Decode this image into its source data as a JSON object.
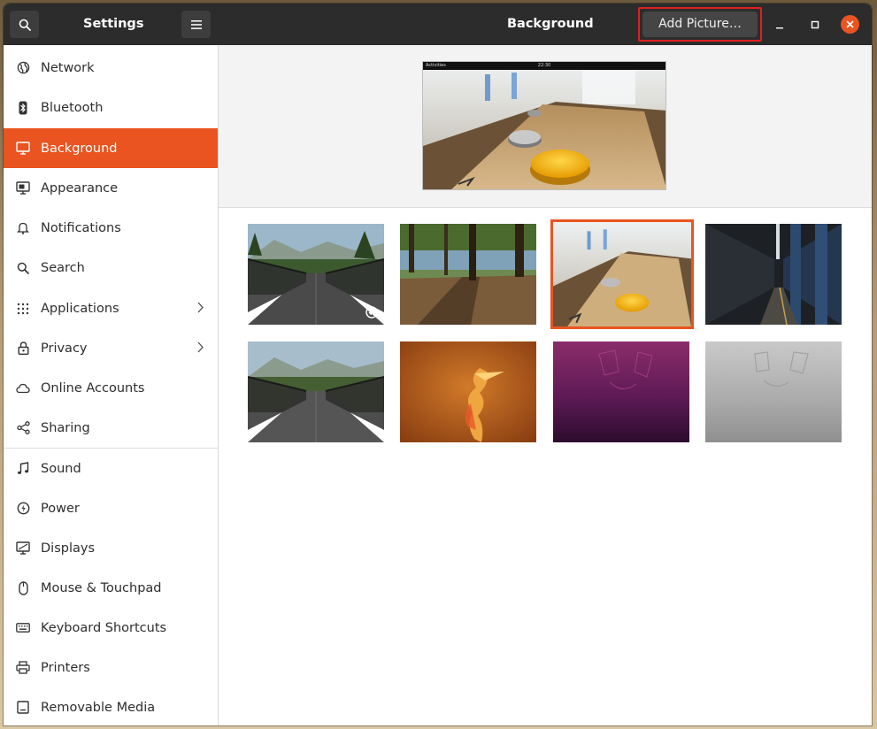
{
  "headerbar": {
    "left_title": "Settings",
    "panel_title": "Background",
    "add_picture_label": "Add Picture…"
  },
  "sidebar": {
    "items": [
      {
        "label": "Network",
        "icon": "network-icon"
      },
      {
        "label": "Bluetooth",
        "icon": "bluetooth-icon"
      },
      {
        "label": "Background",
        "icon": "background-icon",
        "active": true
      },
      {
        "label": "Appearance",
        "icon": "appearance-icon"
      },
      {
        "label": "Notifications",
        "icon": "bell-icon"
      },
      {
        "label": "Search",
        "icon": "search-icon"
      },
      {
        "label": "Applications",
        "icon": "applications-grid-icon",
        "has_submenu": true
      },
      {
        "label": "Privacy",
        "icon": "lock-icon",
        "has_submenu": true
      },
      {
        "label": "Online Accounts",
        "icon": "cloud-icon"
      },
      {
        "label": "Sharing",
        "icon": "share-icon"
      },
      {
        "label": "Sound",
        "icon": "music-note-icon"
      },
      {
        "label": "Power",
        "icon": "power-icon"
      },
      {
        "label": "Displays",
        "icon": "display-icon"
      },
      {
        "label": "Mouse & Touchpad",
        "icon": "mouse-icon"
      },
      {
        "label": "Keyboard Shortcuts",
        "icon": "keyboard-icon"
      },
      {
        "label": "Printers",
        "icon": "printer-icon"
      },
      {
        "label": "Removable Media",
        "icon": "removable-media-icon"
      }
    ]
  },
  "preview": {
    "topbar_activities": "Activities",
    "topbar_clock": "22:30"
  },
  "wallpapers": [
    {
      "name": "bridge-forest",
      "current": true
    },
    {
      "name": "forest-lake"
    },
    {
      "name": "shuffleboard",
      "selected": true
    },
    {
      "name": "subway-corridor"
    },
    {
      "name": "bridge-forest-2"
    },
    {
      "name": "orange-fish"
    },
    {
      "name": "purple-abstract"
    },
    {
      "name": "grey-abstract"
    }
  ],
  "colors": {
    "accent": "#e95420",
    "headerbar": "#2c2c2c",
    "highlight_box": "#e02020"
  }
}
